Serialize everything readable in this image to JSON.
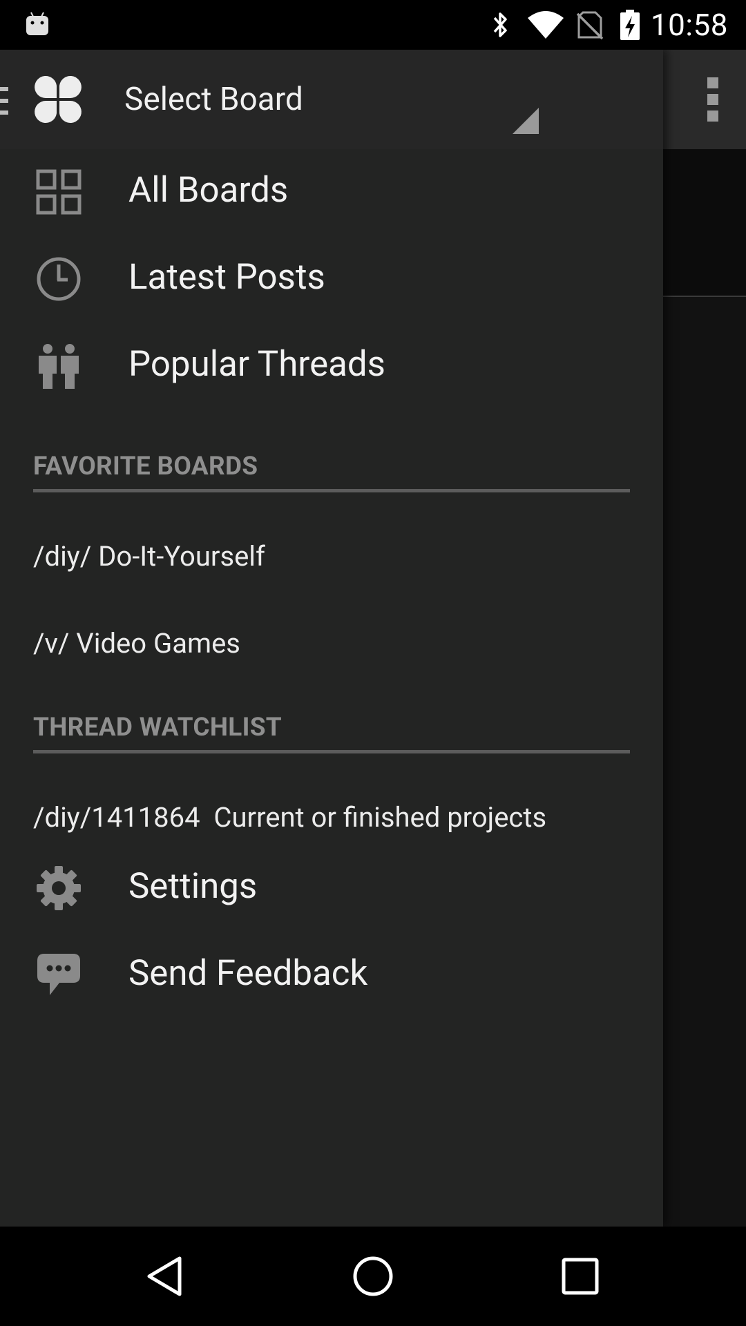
{
  "status_bar": {
    "time": "10:58"
  },
  "header": {
    "board_select_label": "Select Board"
  },
  "nav_items": [
    {
      "label": "All Boards",
      "icon": "grid-icon"
    },
    {
      "label": "Latest Posts",
      "icon": "clock-icon"
    },
    {
      "label": "Popular Threads",
      "icon": "people-icon"
    }
  ],
  "favorites": {
    "title": "FAVORITE BOARDS",
    "items": [
      {
        "label": "/diy/ Do-It-Yourself"
      },
      {
        "label": "/v/ Video Games"
      }
    ]
  },
  "watchlist": {
    "title": "THREAD WATCHLIST",
    "items": [
      {
        "label": "/diy/1411864  Current or finished projects"
      }
    ]
  },
  "footer_items": [
    {
      "label": "Settings",
      "icon": "gear-icon"
    },
    {
      "label": "Send Feedback",
      "icon": "chat-bubble-icon"
    }
  ],
  "colors": {
    "drawer_bg": "#232423",
    "text_primary": "#f2f2f2",
    "section_header": "#8f8f8f"
  }
}
